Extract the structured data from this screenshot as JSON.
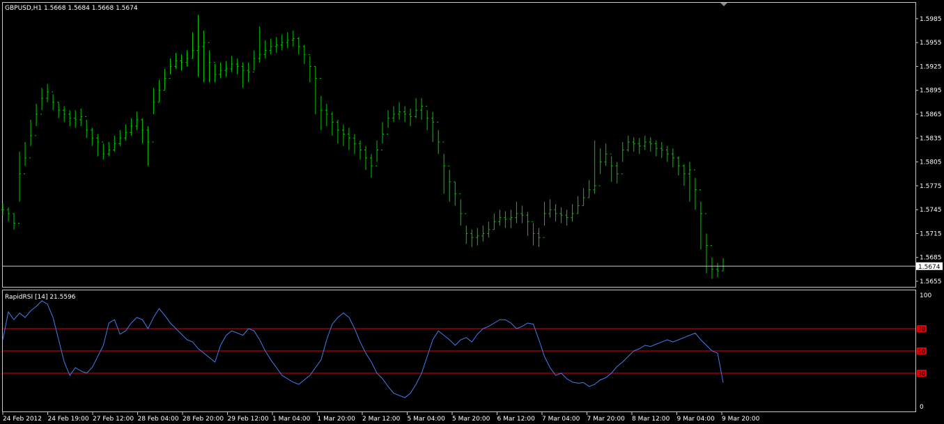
{
  "chart_data": [
    {
      "type": "bar",
      "subtype": "ohlc-bars",
      "title": "GBPUSD,H1  1.5668 1.5684 1.5668 1.5674",
      "symbol": "GBPUSD",
      "timeframe": "H1",
      "last_ohlc": {
        "open": 1.5668,
        "high": 1.5684,
        "low": 1.5668,
        "close": 1.5674
      },
      "current_price_label": "1.5674",
      "current_price": 1.5674,
      "ylim": [
        1.5648,
        1.6005
      ],
      "yticks": [
        1.5985,
        1.5955,
        1.5925,
        1.5895,
        1.5865,
        1.5835,
        1.5805,
        1.5775,
        1.5745,
        1.5715,
        1.5685,
        1.5655
      ],
      "ytick_labels": [
        "1.5985",
        "1.5955",
        "1.5925",
        "1.5895",
        "1.5865",
        "1.5835",
        "1.5805",
        "1.5775",
        "1.5745",
        "1.5715",
        "1.5685",
        "1.5655"
      ],
      "bar_color": "#00c800",
      "background": "#000000",
      "grid": false,
      "x": [
        0,
        2,
        4,
        6,
        8,
        10,
        12,
        14,
        16,
        18,
        20,
        22,
        24,
        26,
        28,
        30,
        32,
        34,
        36,
        38,
        40,
        42,
        44,
        46,
        48,
        50,
        52,
        54,
        56,
        58,
        60,
        62,
        64,
        66,
        68,
        70,
        72,
        74,
        76,
        78,
        80,
        82,
        84,
        86,
        88,
        90,
        92,
        94,
        96,
        98,
        100,
        102,
        104,
        106,
        108,
        110,
        112,
        114,
        116,
        118,
        120,
        122,
        124,
        126,
        128,
        130,
        132,
        134,
        136,
        138,
        140,
        142,
        144,
        146,
        148,
        150,
        152,
        154,
        156,
        158,
        160,
        162,
        164,
        166,
        168,
        170,
        172,
        174,
        176,
        178,
        180,
        182,
        184,
        186,
        188,
        190,
        192,
        194,
        196,
        198,
        200,
        202,
        204,
        206,
        208,
        210,
        212,
        214,
        216,
        218,
        220,
        222,
        224,
        226,
        228,
        230,
        232,
        234,
        236,
        238,
        240,
        242,
        244,
        246,
        248,
        250,
        252,
        254,
        256,
        258
      ],
      "close": [
        1.5745,
        1.574,
        1.5728,
        1.579,
        1.581,
        1.5838,
        1.5865,
        1.5885,
        1.5893,
        1.588,
        1.587,
        1.5865,
        1.586,
        1.5858,
        1.5862,
        1.5845,
        1.5835,
        1.583,
        1.5815,
        1.582,
        1.5828,
        1.5835,
        1.5842,
        1.585,
        1.5858,
        1.5845,
        1.583,
        1.588,
        1.5895,
        1.591,
        1.5925,
        1.5932,
        1.593,
        1.5935,
        1.5945,
        1.595,
        1.5955,
        1.593,
        1.5915,
        1.592,
        1.5922,
        1.5928,
        1.5925,
        1.592,
        1.5918,
        1.5935,
        1.594,
        1.5945,
        1.595,
        1.5952,
        1.5955,
        1.5958,
        1.596,
        1.595,
        1.594,
        1.5925,
        1.591,
        1.587,
        1.5865,
        1.5855,
        1.5845,
        1.584,
        1.5835,
        1.5828,
        1.582,
        1.581,
        1.58,
        1.582,
        1.584,
        1.586,
        1.5865,
        1.5868,
        1.5865,
        1.5862,
        1.587,
        1.5875,
        1.586,
        1.5855,
        1.583,
        1.58,
        1.578,
        1.5765,
        1.574,
        1.5715,
        1.571,
        1.5712,
        1.5715,
        1.572,
        1.573,
        1.5735,
        1.5733,
        1.5735,
        1.574,
        1.5738,
        1.573,
        1.5715,
        1.571,
        1.574,
        1.5745,
        1.574,
        1.5738,
        1.5735,
        1.574,
        1.575,
        1.576,
        1.577,
        1.5775,
        1.5805,
        1.5815,
        1.58,
        1.579,
        1.582,
        1.583,
        1.5828,
        1.5825,
        1.583,
        1.5828,
        1.5822,
        1.582,
        1.5815,
        1.581,
        1.58,
        1.579,
        1.5795,
        1.577,
        1.574,
        1.57,
        1.567,
        1.5668,
        1.5674
      ],
      "high": [
        1.5753,
        1.5748,
        1.574,
        1.5818,
        1.583,
        1.5858,
        1.5878,
        1.5898,
        1.5903,
        1.589,
        1.588,
        1.5875,
        1.587,
        1.587,
        1.5872,
        1.5858,
        1.5848,
        1.584,
        1.5828,
        1.583,
        1.5838,
        1.5845,
        1.5852,
        1.586,
        1.5868,
        1.586,
        1.585,
        1.5898,
        1.5908,
        1.5922,
        1.5935,
        1.5942,
        1.594,
        1.5945,
        1.5968,
        1.599,
        1.597,
        1.5945,
        1.5928,
        1.593,
        1.5932,
        1.5938,
        1.5935,
        1.593,
        1.593,
        1.5945,
        1.5975,
        1.5958,
        1.596,
        1.5962,
        1.5965,
        1.5968,
        1.597,
        1.5962,
        1.5952,
        1.5938,
        1.5925,
        1.5888,
        1.5878,
        1.5868,
        1.5858,
        1.5852,
        1.5848,
        1.584,
        1.5832,
        1.5825,
        1.5815,
        1.5832,
        1.5855,
        1.587,
        1.5875,
        1.588,
        1.5875,
        1.5872,
        1.5885,
        1.5885,
        1.587,
        1.5868,
        1.5845,
        1.5815,
        1.5795,
        1.578,
        1.5758,
        1.5725,
        1.572,
        1.5722,
        1.5725,
        1.573,
        1.574,
        1.5745,
        1.5743,
        1.5745,
        1.5755,
        1.575,
        1.5742,
        1.5728,
        1.5722,
        1.5755,
        1.5758,
        1.5752,
        1.5748,
        1.5745,
        1.5752,
        1.5762,
        1.5772,
        1.5782,
        1.5832,
        1.5822,
        1.5828,
        1.5812,
        1.5805,
        1.583,
        1.5838,
        1.5836,
        1.5835,
        1.5838,
        1.5836,
        1.5832,
        1.583,
        1.5825,
        1.5822,
        1.5812,
        1.5802,
        1.5805,
        1.5785,
        1.5755,
        1.5715,
        1.5685,
        1.5678,
        1.5684
      ],
      "low": [
        1.5738,
        1.573,
        1.572,
        1.5755,
        1.58,
        1.5825,
        1.585,
        1.587,
        1.588,
        1.587,
        1.586,
        1.5855,
        1.585,
        1.5848,
        1.585,
        1.5835,
        1.5825,
        1.5812,
        1.5808,
        1.5812,
        1.5818,
        1.5825,
        1.5832,
        1.5838,
        1.5845,
        1.5828,
        1.58,
        1.5865,
        1.588,
        1.5895,
        1.5915,
        1.5922,
        1.592,
        1.5925,
        1.5935,
        1.5912,
        1.5905,
        1.5905,
        1.5905,
        1.591,
        1.5912,
        1.5918,
        1.5915,
        1.5898,
        1.5905,
        1.592,
        1.593,
        1.5935,
        1.594,
        1.5942,
        1.5945,
        1.5948,
        1.595,
        1.594,
        1.5928,
        1.5905,
        1.5865,
        1.5845,
        1.585,
        1.5838,
        1.5828,
        1.5825,
        1.582,
        1.5815,
        1.5808,
        1.5795,
        1.5785,
        1.5805,
        1.5828,
        1.5848,
        1.5855,
        1.5858,
        1.5855,
        1.585,
        1.586,
        1.5858,
        1.5845,
        1.583,
        1.5815,
        1.5765,
        1.5755,
        1.575,
        1.5725,
        1.5702,
        1.5698,
        1.57,
        1.5705,
        1.571,
        1.572,
        1.5725,
        1.5722,
        1.5722,
        1.5728,
        1.5728,
        1.5712,
        1.57,
        1.5698,
        1.5725,
        1.5735,
        1.573,
        1.5728,
        1.5725,
        1.573,
        1.574,
        1.575,
        1.576,
        1.5765,
        1.579,
        1.58,
        1.578,
        1.5778,
        1.5805,
        1.5818,
        1.5818,
        1.5815,
        1.582,
        1.5818,
        1.5812,
        1.581,
        1.5805,
        1.5798,
        1.5788,
        1.5775,
        1.5755,
        1.5745,
        1.5695,
        1.5665,
        1.5658,
        1.566,
        1.5668
      ]
    },
    {
      "type": "line",
      "title": "RapidRSI [14] 21.5596",
      "indicator": "RapidRSI",
      "period": 14,
      "last_value": 21.5596,
      "ylim": [
        0,
        100
      ],
      "yticks": [
        100,
        0
      ],
      "levels": [
        70,
        50,
        30
      ],
      "level_labels": [
        "70",
        "50",
        "30"
      ],
      "line_color": "#3f7ff0",
      "level_color": "#e00000",
      "x": [
        0,
        2,
        4,
        6,
        8,
        10,
        12,
        14,
        16,
        18,
        20,
        22,
        24,
        26,
        28,
        30,
        32,
        34,
        36,
        38,
        40,
        42,
        44,
        46,
        48,
        50,
        52,
        54,
        56,
        58,
        60,
        62,
        64,
        66,
        68,
        70,
        72,
        74,
        76,
        78,
        80,
        82,
        84,
        86,
        88,
        90,
        92,
        94,
        96,
        98,
        100,
        102,
        104,
        106,
        108,
        110,
        112,
        114,
        116,
        118,
        120,
        122,
        124,
        126,
        128,
        130,
        132,
        134,
        136,
        138,
        140,
        142,
        144,
        146,
        148,
        150,
        152,
        154,
        156,
        158,
        160,
        162,
        164,
        166,
        168,
        170,
        172,
        174,
        176,
        178,
        180,
        182,
        184,
        186,
        188,
        190,
        192,
        194,
        196,
        198,
        200,
        202,
        204,
        206,
        208,
        210,
        212,
        214,
        216,
        218,
        220,
        222,
        224,
        226,
        228,
        230,
        232,
        234,
        236,
        238,
        240,
        242,
        244,
        246,
        248,
        250,
        252,
        254,
        256,
        258
      ],
      "y": [
        60,
        85,
        78,
        84,
        80,
        86,
        90,
        95,
        92,
        80,
        60,
        40,
        28,
        35,
        32,
        30,
        35,
        45,
        55,
        75,
        78,
        65,
        68,
        75,
        80,
        78,
        70,
        80,
        88,
        82,
        75,
        70,
        65,
        60,
        58,
        52,
        48,
        44,
        40,
        55,
        64,
        68,
        66,
        64,
        70,
        68,
        60,
        50,
        42,
        35,
        28,
        25,
        22,
        20,
        24,
        28,
        35,
        42,
        60,
        74,
        80,
        84,
        80,
        70,
        58,
        48,
        40,
        30,
        25,
        18,
        12,
        10,
        8,
        12,
        20,
        30,
        45,
        60,
        68,
        64,
        60,
        55,
        60,
        62,
        58,
        65,
        70,
        72,
        75,
        78,
        78,
        75,
        70,
        72,
        75,
        74,
        60,
        45,
        35,
        28,
        30,
        25,
        22,
        21,
        21.5596,
        18,
        20,
        24,
        26,
        30,
        36,
        40,
        45,
        50,
        52,
        55,
        54,
        56,
        58,
        60,
        58,
        60,
        62,
        64,
        66,
        60,
        55,
        50,
        48,
        21.5596
      ],
      "y_note": ""
    }
  ],
  "x_axis": {
    "tick_labels": [
      "24 Feb 2012",
      "24 Feb 19:00",
      "27 Feb 12:00",
      "28 Feb 04:00",
      "28 Feb 20:00",
      "29 Feb 12:00",
      "1 Mar 04:00",
      "1 Mar 20:00",
      "2 Mar 12:00",
      "5 Mar 04:00",
      "5 Mar 20:00",
      "6 Mar 12:00",
      "7 Mar 04:00",
      "7 Mar 20:00",
      "8 Mar 12:00",
      "9 Mar 04:00",
      "9 Mar 20:00"
    ]
  }
}
